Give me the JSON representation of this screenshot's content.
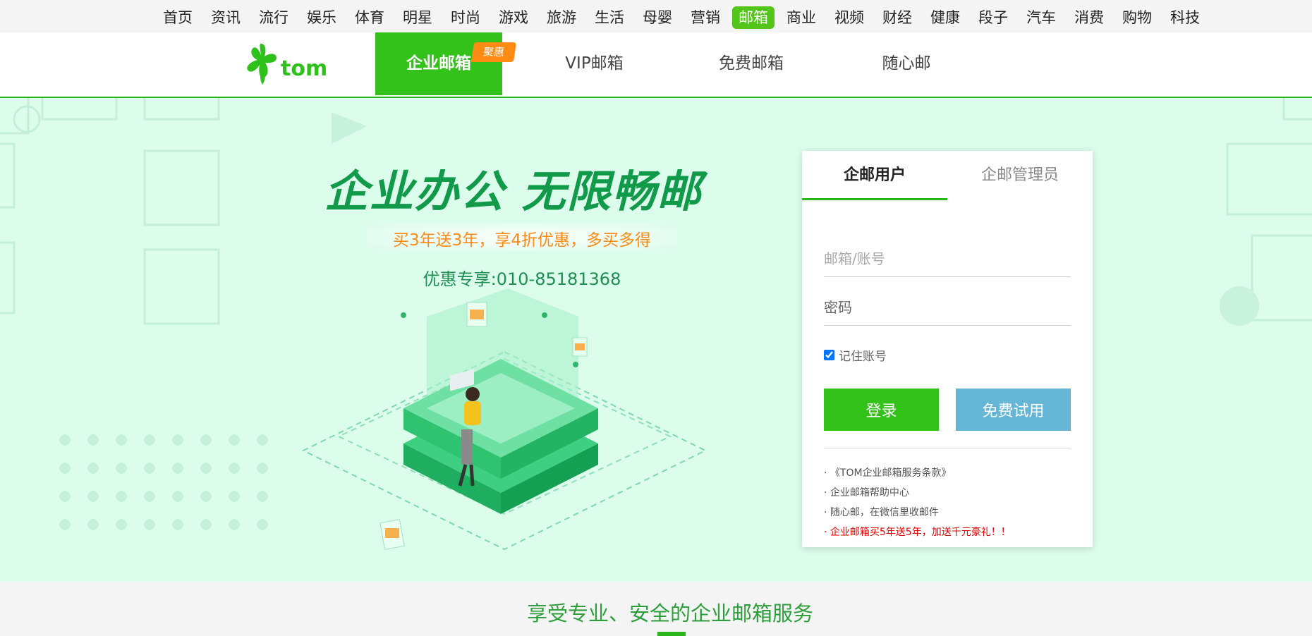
{
  "top_nav": {
    "items": [
      "首页",
      "资讯",
      "流行",
      "娱乐",
      "体育",
      "明星",
      "时尚",
      "游戏",
      "旅游",
      "生活",
      "母婴",
      "营销",
      "邮箱",
      "商业",
      "视频",
      "财经",
      "健康",
      "段子",
      "汽车",
      "消费",
      "购物",
      "科技"
    ],
    "active_index": 12
  },
  "brand": {
    "logo_text": "tom",
    "tabs": [
      "企业邮箱",
      "VIP邮箱",
      "免费邮箱",
      "随心邮"
    ],
    "active_tab": "企业邮箱",
    "discount_tag": "聚惠"
  },
  "hero": {
    "slogan": "企业办公  无限畅邮",
    "promo": "买3年送3年，享4折优惠，多买多得",
    "hotline": "优惠专享:010-85181368"
  },
  "login": {
    "tabs": [
      "企邮用户",
      "企邮管理员"
    ],
    "active_tab": "企邮用户",
    "account_placeholder": "邮箱/账号",
    "password_placeholder": "密码",
    "remember_label": "记住账号",
    "remember_checked": true,
    "login_button": "登录",
    "trial_button": "免费试用",
    "links": [
      "· 《TOM企业邮箱服务条款》",
      "· 企业邮箱帮助中心",
      "· 随心邮，在微信里收邮件",
      "· 企业邮箱买5年送5年，加送千元豪礼！！"
    ]
  },
  "bottom": {
    "title": "享受专业、安全的企业邮箱服务"
  },
  "colors": {
    "brand_green": "#33c21a",
    "hero_bg": "#dcfcec",
    "slogan_green": "#119a4a",
    "promo_orange": "#ff8a14",
    "trial_blue": "#65b5d6",
    "alert_red": "#e20000"
  }
}
